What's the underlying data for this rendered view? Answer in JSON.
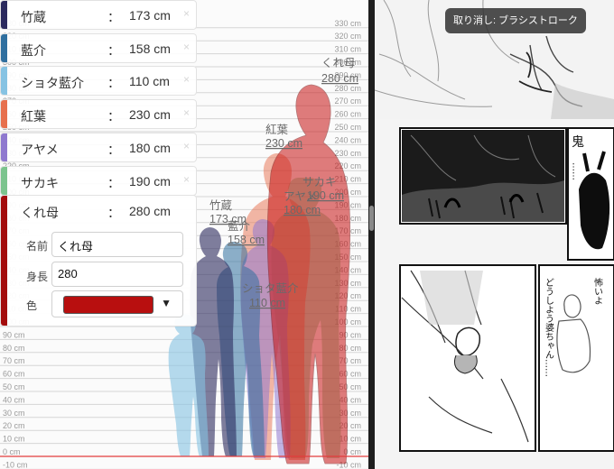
{
  "chart": {
    "grid_labels": [
      "-10 cm",
      "0 cm",
      "10 cm",
      "20 cm",
      "30 cm",
      "40 cm",
      "50 cm",
      "60 cm",
      "70 cm",
      "80 cm",
      "90 cm",
      "100 cm",
      "110 cm",
      "120 cm",
      "130 cm",
      "140 cm",
      "150 cm",
      "160 cm",
      "170 cm",
      "180 cm",
      "190 cm",
      "200 cm",
      "210 cm",
      "220 cm",
      "230 cm",
      "240 cm",
      "250 cm",
      "260 cm",
      "270 cm",
      "280 cm",
      "290 cm",
      "300 cm",
      "310 cm",
      "320 cm",
      "330 cm"
    ],
    "baseline_color": "#e23c3c",
    "figures": [
      {
        "name": "竹蔵",
        "height_label": "173 cm",
        "height_cm": 173,
        "color": "#2b2a5e"
      },
      {
        "name": "藍介",
        "height_label": "158 cm",
        "height_cm": 158,
        "color": "#2f6f9f"
      },
      {
        "name": "ショタ藍介",
        "height_label": "110 cm",
        "height_cm": 110,
        "color": "#86c3e3"
      },
      {
        "name": "紅葉",
        "height_label": "230 cm",
        "height_cm": 230,
        "color": "#e7704d"
      },
      {
        "name": "アヤメ",
        "height_label": "180 cm",
        "height_cm": 180,
        "color": "#8f79cf"
      },
      {
        "name": "サカキ",
        "height_label": "190 cm",
        "height_cm": 190,
        "color": "#7cc48e"
      },
      {
        "name": "くれ母",
        "height_label": "280 cm",
        "height_cm": 280,
        "color": "#c81414"
      }
    ]
  },
  "character_list": [
    {
      "name": "竹蔵",
      "colon": "：",
      "height": "173 cm",
      "delete_glyph": "×",
      "color": "#2b2a5e"
    },
    {
      "name": "藍介",
      "colon": "：",
      "height": "158 cm",
      "delete_glyph": "×",
      "color": "#2f6f9f"
    },
    {
      "name": "ショタ藍介",
      "colon": "：",
      "height": "110 cm",
      "delete_glyph": "×",
      "color": "#86c3e3"
    },
    {
      "name": "紅葉",
      "colon": "：",
      "height": "230 cm",
      "delete_glyph": "×",
      "color": "#e7704d"
    },
    {
      "name": "アヤメ",
      "colon": "：",
      "height": "180 cm",
      "delete_glyph": "×",
      "color": "#8f79cf"
    },
    {
      "name": "サカキ",
      "colon": "：",
      "height": "190 cm",
      "delete_glyph": "×",
      "color": "#7cc48e"
    }
  ],
  "editor": {
    "name": "くれ母",
    "colon": "：",
    "height": "280 cm",
    "swatch_color": "#a30c0c",
    "name_label": "名前",
    "name_value": "くれ母",
    "height_label": "身長",
    "height_value": "280",
    "color_label": "色",
    "color_value": "#b80f0f",
    "color_dropdown_glyph": "▼"
  },
  "manga": {
    "undo_toast": "取り消し: ブラシストローク",
    "panel_text_oni": "鬼",
    "panel_text_dots": "……",
    "panel_text_kowai": "怖いよ",
    "panel_text_doshiyo": "どうしよう婆ちゃん……"
  }
}
